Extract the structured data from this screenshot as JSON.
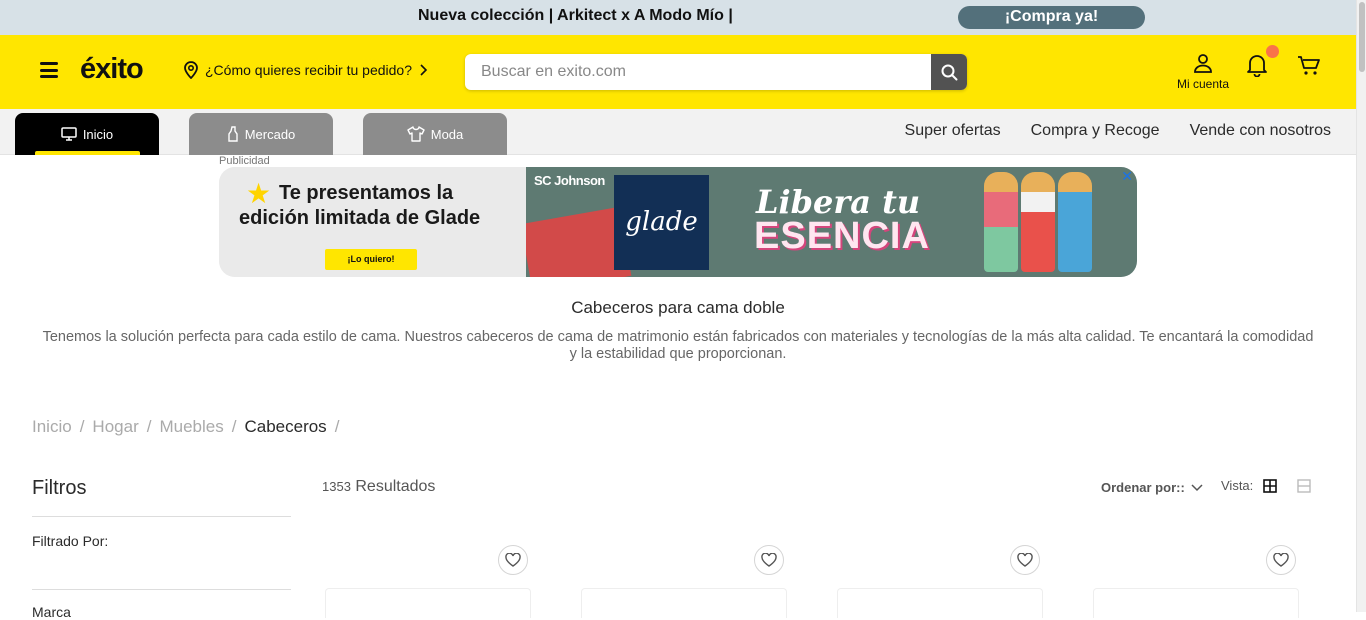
{
  "promo": {
    "text": "Nueva colección | Arkitect x A Modo Mío |",
    "cta": "¡Compra ya!"
  },
  "header": {
    "logo": "éxito",
    "delivery": "¿Cómo quieres recibir tu pedido?",
    "search_placeholder": "Buscar en exito.com",
    "account_label": "Mi cuenta"
  },
  "nav": {
    "tabs": [
      {
        "label": "Inicio",
        "icon": "monitor-icon"
      },
      {
        "label": "Mercado",
        "icon": "bottle-icon"
      },
      {
        "label": "Moda",
        "icon": "shirt-icon"
      }
    ],
    "links": [
      "Super ofertas",
      "Compra y Recoge",
      "Vende con nosotros"
    ]
  },
  "ad": {
    "label": "Publicidad",
    "headline_1": "Te presentamos la",
    "headline_2": "edición limitada de Glade",
    "cta": "¡Lo quiero!",
    "brand_1": "SC Johnson",
    "brand_2": "glade",
    "slogan_1": "Libera tu",
    "slogan_2": "ESENCIA",
    "close": "✕"
  },
  "category": {
    "title": "Cabeceros para cama doble",
    "description": "Tenemos la solución perfecta para cada estilo de cama. Nuestros cabeceros de cama de matrimonio están fabricados con materiales y tecnologías de la más alta calidad. Te encantará la comodidad y la estabilidad que proporcionan."
  },
  "breadcrumb": [
    "Inicio",
    "Hogar",
    "Muebles",
    "Cabeceros"
  ],
  "filters": {
    "title": "Filtros",
    "filtered_by": "Filtrado Por:",
    "brand": "Marca"
  },
  "results": {
    "count": "1353",
    "label": "Resultados"
  },
  "sort": {
    "label": "Ordenar por::"
  },
  "view": {
    "label": "Vista:"
  },
  "colors": {
    "brand_yellow": "#ffe600",
    "promo_bg": "#d7e1e7",
    "promo_cta": "#53707b",
    "badge": "#f97349"
  }
}
